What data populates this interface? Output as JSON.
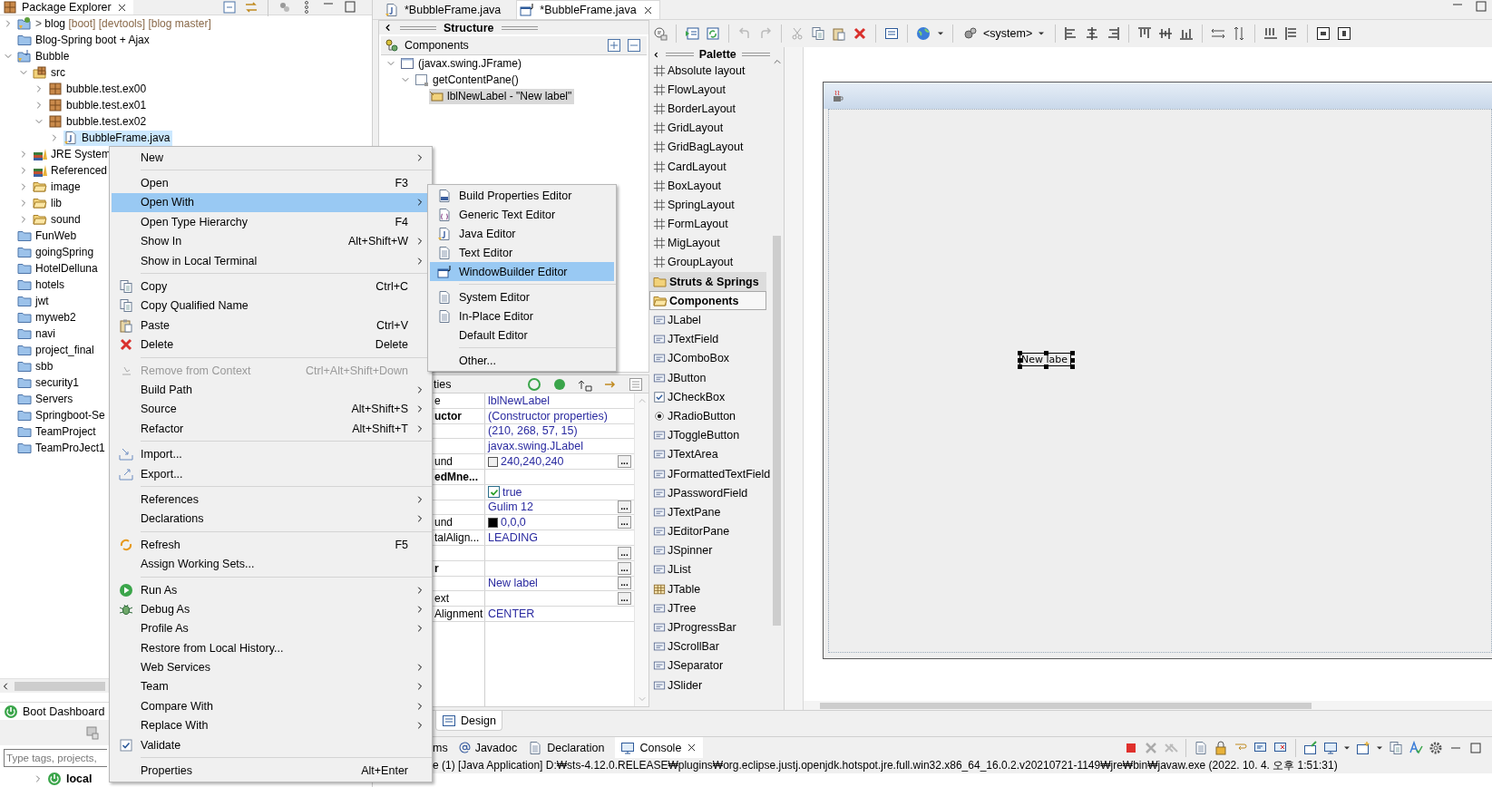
{
  "package_explorer": {
    "title": "Package Explorer",
    "selected": true,
    "tree": [
      {
        "label": "blog",
        "prefix": ">",
        "decoration": "[boot] [devtools] [blog master]",
        "kind": "boot-project",
        "expanded": false,
        "selected": false
      },
      {
        "label": "Blog-Spring boot + Ajax",
        "kind": "project",
        "selected": false
      },
      {
        "label": "Bubble",
        "kind": "java-project",
        "expanded": true,
        "selected": false,
        "children": [
          {
            "label": "src",
            "kind": "source-folder",
            "expanded": true,
            "selected": false,
            "children": [
              {
                "label": "bubble.test.ex00",
                "kind": "package",
                "expanded": false,
                "selected": false
              },
              {
                "label": "bubble.test.ex01",
                "kind": "package",
                "expanded": false,
                "selected": false
              },
              {
                "label": "bubble.test.ex02",
                "kind": "package",
                "expanded": true,
                "selected": false,
                "children": [
                  {
                    "label": "BubbleFrame.java",
                    "kind": "java-file",
                    "expanded": false,
                    "selected": true
                  }
                ]
              }
            ]
          },
          {
            "label": "JRE System",
            "kind": "library",
            "expanded": false,
            "selected": false
          },
          {
            "label": "Referenced",
            "kind": "library",
            "expanded": false,
            "selected": false
          },
          {
            "label": "image",
            "kind": "folder",
            "expanded": false,
            "selected": false
          },
          {
            "label": "lib",
            "kind": "folder",
            "expanded": false,
            "selected": false
          },
          {
            "label": "sound",
            "kind": "folder",
            "expanded": false,
            "selected": false
          }
        ]
      },
      {
        "label": "FunWeb",
        "kind": "project",
        "selected": false
      },
      {
        "label": "goingSpring",
        "kind": "project",
        "selected": false
      },
      {
        "label": "HotelDelluna",
        "kind": "project",
        "selected": false
      },
      {
        "label": "hotels",
        "kind": "project",
        "selected": false
      },
      {
        "label": "jwt",
        "kind": "project",
        "selected": false
      },
      {
        "label": "myweb2",
        "kind": "project",
        "selected": false
      },
      {
        "label": "navi",
        "kind": "project",
        "selected": false
      },
      {
        "label": "project_final",
        "kind": "project",
        "selected": false
      },
      {
        "label": "sbb",
        "kind": "project",
        "selected": false
      },
      {
        "label": "security1",
        "kind": "project",
        "selected": false
      },
      {
        "label": "Servers",
        "kind": "project",
        "selected": false
      },
      {
        "label": "Springboot-Se",
        "kind": "project",
        "selected": false
      },
      {
        "label": "TeamProject",
        "kind": "project",
        "selected": false
      },
      {
        "label": "TeamProJect1",
        "kind": "project",
        "selected": false
      }
    ]
  },
  "boot_dashboard": {
    "title": "Boot Dashboard",
    "search": {
      "placeholder": "Type tags, projects,"
    },
    "tree": [
      {
        "label": "local",
        "expanded": false
      }
    ]
  },
  "editor_tabs": [
    {
      "label": "*BubbleFrame.java",
      "selected": false
    },
    {
      "label": "*BubbleFrame.java",
      "selected": true
    }
  ],
  "structure": {
    "title": "Structure",
    "components_title": "Components",
    "tree": [
      {
        "label": "(javax.swing.JFrame)",
        "expanded": true,
        "selected": false,
        "children": [
          {
            "label": "getContentPane()",
            "expanded": true,
            "selected": false,
            "children": [
              {
                "label": "lblNewLabel - \"New label\"",
                "selected": true
              }
            ]
          }
        ]
      }
    ]
  },
  "properties": {
    "title": "ties",
    "rows": [
      {
        "name": "e",
        "bold": false,
        "value": "lblNewLabel"
      },
      {
        "name": "uctor",
        "bold": true,
        "value": "(Constructor properties)"
      },
      {
        "name": "",
        "value": "(210, 268, 57, 15)"
      },
      {
        "name": "",
        "value": "javax.swing.JLabel"
      },
      {
        "name": "und",
        "bold": false,
        "value": "240,240,240",
        "color": "#f0f0f0",
        "button": "..."
      },
      {
        "name": "edMne...",
        "bold": true,
        "value": ""
      },
      {
        "name": "",
        "value": "true",
        "checked": true
      },
      {
        "name": "",
        "value": "Gulim 12",
        "button": "..."
      },
      {
        "name": "und",
        "bold": false,
        "value": "0,0,0",
        "color": "#000000",
        "button": "..."
      },
      {
        "name": "talAlign...",
        "bold": false,
        "value": "LEADING"
      },
      {
        "name": "",
        "value": "",
        "button": "..."
      },
      {
        "name": "r",
        "bold": true,
        "value": "",
        "button": "..."
      },
      {
        "name": "",
        "value": "New label",
        "button": "..."
      },
      {
        "name": "ext",
        "bold": false,
        "value": "",
        "button": "..."
      },
      {
        "name": "Alignment",
        "bold": false,
        "value": "CENTER"
      }
    ]
  },
  "toolbar": {
    "look_and_feel": "<system>"
  },
  "palette": {
    "title": "Palette",
    "items": [
      {
        "label": "Absolute layout",
        "kind": "layout"
      },
      {
        "label": "FlowLayout",
        "kind": "layout"
      },
      {
        "label": "BorderLayout",
        "kind": "layout"
      },
      {
        "label": "GridLayout",
        "kind": "layout"
      },
      {
        "label": "GridBagLayout",
        "kind": "layout"
      },
      {
        "label": "CardLayout",
        "kind": "layout"
      },
      {
        "label": "BoxLayout",
        "kind": "layout"
      },
      {
        "label": "SpringLayout",
        "kind": "layout"
      },
      {
        "label": "FormLayout",
        "kind": "layout"
      },
      {
        "label": "MigLayout",
        "kind": "layout"
      },
      {
        "label": "GroupLayout",
        "kind": "layout"
      },
      {
        "label": "Struts & Springs",
        "kind": "category",
        "expanded": false
      },
      {
        "label": "Components",
        "kind": "category",
        "expanded": true
      },
      {
        "label": "JLabel",
        "kind": "component"
      },
      {
        "label": "JTextField",
        "kind": "component"
      },
      {
        "label": "JComboBox",
        "kind": "component"
      },
      {
        "label": "JButton",
        "kind": "component"
      },
      {
        "label": "JCheckBox",
        "kind": "component"
      },
      {
        "label": "JRadioButton",
        "kind": "component"
      },
      {
        "label": "JToggleButton",
        "kind": "component"
      },
      {
        "label": "JTextArea",
        "kind": "component"
      },
      {
        "label": "JFormattedTextField",
        "kind": "component"
      },
      {
        "label": "JPasswordField",
        "kind": "component"
      },
      {
        "label": "JTextPane",
        "kind": "component"
      },
      {
        "label": "JEditorPane",
        "kind": "component"
      },
      {
        "label": "JSpinner",
        "kind": "component"
      },
      {
        "label": "JList",
        "kind": "component"
      },
      {
        "label": "JTable",
        "kind": "component"
      },
      {
        "label": "JTree",
        "kind": "component"
      },
      {
        "label": "JProgressBar",
        "kind": "component"
      },
      {
        "label": "JScrollBar",
        "kind": "component"
      },
      {
        "label": "JSeparator",
        "kind": "component"
      },
      {
        "label": "JSlider",
        "kind": "component"
      }
    ]
  },
  "canvas": {
    "label_text": "New labe",
    "label_selected": true
  },
  "design_tabs": [
    {
      "label": "Design",
      "selected": true
    }
  ],
  "console": {
    "tabs": [
      {
        "label": "ms",
        "selected": false
      },
      {
        "label": "Javadoc",
        "selected": false
      },
      {
        "label": "Declaration",
        "selected": false
      },
      {
        "label": "Console",
        "selected": true
      }
    ],
    "line": "e (1) [Java Application] D:₩sts-4.12.0.RELEASE₩plugins₩org.eclipse.justj.openjdk.hotspot.jre.full.win32.x86_64_16.0.2.v20210721-1149₩jre₩bin₩javaw.exe  (2022. 10. 4. 오후 1:51:31)"
  },
  "context_menu": {
    "items": [
      {
        "kind": "item",
        "label": "New",
        "submenu": true,
        "disabled": false,
        "selected": false
      },
      {
        "kind": "separator"
      },
      {
        "kind": "item",
        "label": "Open",
        "shortcut": "F3",
        "submenu": false,
        "disabled": false,
        "selected": false
      },
      {
        "kind": "item",
        "label": "Open With",
        "submenu": true,
        "disabled": false,
        "selected": true
      },
      {
        "kind": "item",
        "label": "Open Type Hierarchy",
        "shortcut": "F4",
        "submenu": false,
        "disabled": false,
        "selected": false
      },
      {
        "kind": "item",
        "label": "Show In",
        "shortcut": "Alt+Shift+W",
        "submenu": true,
        "disabled": false,
        "selected": false
      },
      {
        "kind": "item",
        "label": "Show in Local Terminal",
        "submenu": true,
        "disabled": false,
        "selected": false
      },
      {
        "kind": "separator"
      },
      {
        "kind": "item",
        "label": "Copy",
        "shortcut": "Ctrl+C",
        "submenu": false,
        "disabled": false,
        "selected": false
      },
      {
        "kind": "item",
        "label": "Copy Qualified Name",
        "submenu": false,
        "disabled": false,
        "selected": false
      },
      {
        "kind": "item",
        "label": "Paste",
        "shortcut": "Ctrl+V",
        "submenu": false,
        "disabled": false,
        "selected": false
      },
      {
        "kind": "item",
        "label": "Delete",
        "shortcut": "Delete",
        "submenu": false,
        "disabled": false,
        "selected": false
      },
      {
        "kind": "separator"
      },
      {
        "kind": "item",
        "label": "Remove from Context",
        "shortcut": "Ctrl+Alt+Shift+Down",
        "submenu": false,
        "disabled": true,
        "selected": false
      },
      {
        "kind": "item",
        "label": "Build Path",
        "submenu": true,
        "disabled": false,
        "selected": false
      },
      {
        "kind": "item",
        "label": "Source",
        "shortcut": "Alt+Shift+S",
        "submenu": true,
        "disabled": false,
        "selected": false
      },
      {
        "kind": "item",
        "label": "Refactor",
        "shortcut": "Alt+Shift+T",
        "submenu": true,
        "disabled": false,
        "selected": false
      },
      {
        "kind": "separator"
      },
      {
        "kind": "item",
        "label": "Import...",
        "submenu": false,
        "disabled": false,
        "selected": false
      },
      {
        "kind": "item",
        "label": "Export...",
        "submenu": false,
        "disabled": false,
        "selected": false
      },
      {
        "kind": "separator"
      },
      {
        "kind": "item",
        "label": "References",
        "submenu": true,
        "disabled": false,
        "selected": false
      },
      {
        "kind": "item",
        "label": "Declarations",
        "submenu": true,
        "disabled": false,
        "selected": false
      },
      {
        "kind": "separator"
      },
      {
        "kind": "item",
        "label": "Refresh",
        "shortcut": "F5",
        "submenu": false,
        "disabled": false,
        "selected": false
      },
      {
        "kind": "item",
        "label": "Assign Working Sets...",
        "submenu": false,
        "disabled": false,
        "selected": false
      },
      {
        "kind": "separator"
      },
      {
        "kind": "item",
        "label": "Run As",
        "submenu": true,
        "disabled": false,
        "selected": false
      },
      {
        "kind": "item",
        "label": "Debug As",
        "submenu": true,
        "disabled": false,
        "selected": false
      },
      {
        "kind": "item",
        "label": "Profile As",
        "submenu": true,
        "disabled": false,
        "selected": false
      },
      {
        "kind": "item",
        "label": "Restore from Local History...",
        "submenu": false,
        "disabled": false,
        "selected": false
      },
      {
        "kind": "item",
        "label": "Web Services",
        "submenu": true,
        "disabled": false,
        "selected": false
      },
      {
        "kind": "item",
        "label": "Team",
        "submenu": true,
        "disabled": false,
        "selected": false
      },
      {
        "kind": "item",
        "label": "Compare With",
        "submenu": true,
        "disabled": false,
        "selected": false
      },
      {
        "kind": "item",
        "label": "Replace With",
        "submenu": true,
        "disabled": false,
        "selected": false
      },
      {
        "kind": "item",
        "label": "Validate",
        "submenu": false,
        "disabled": false,
        "selected": false
      },
      {
        "kind": "separator"
      },
      {
        "kind": "item",
        "label": "Properties",
        "shortcut": "Alt+Enter",
        "submenu": false,
        "disabled": false,
        "selected": false
      }
    ]
  },
  "open_with_menu": {
    "items": [
      {
        "kind": "item",
        "label": "Build Properties Editor",
        "selected": false
      },
      {
        "kind": "item",
        "label": "Generic Text Editor",
        "selected": false
      },
      {
        "kind": "item",
        "label": "Java Editor",
        "selected": false
      },
      {
        "kind": "item",
        "label": "Text Editor",
        "selected": false
      },
      {
        "kind": "item",
        "label": "WindowBuilder Editor",
        "selected": true
      },
      {
        "kind": "separator"
      },
      {
        "kind": "item",
        "label": "System Editor",
        "selected": false
      },
      {
        "kind": "item",
        "label": "In-Place Editor",
        "selected": false
      },
      {
        "kind": "item",
        "label": "Default Editor",
        "selected": false
      },
      {
        "kind": "separator"
      },
      {
        "kind": "item",
        "label": "Other...",
        "selected": false
      }
    ]
  }
}
